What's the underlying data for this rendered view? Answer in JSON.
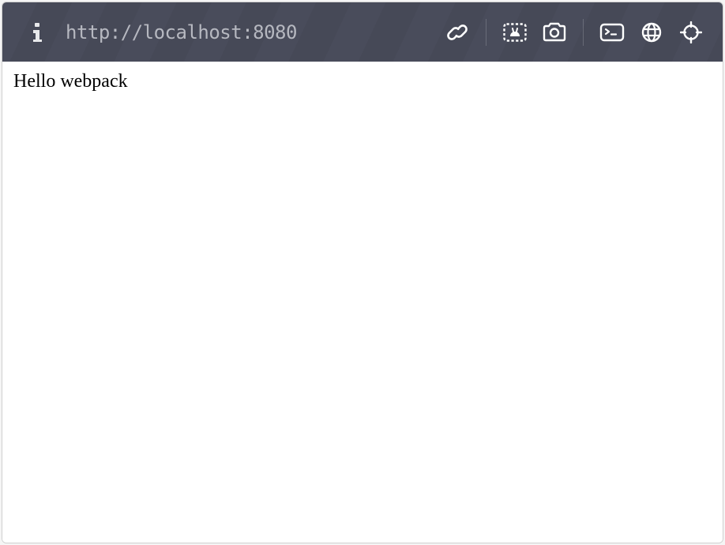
{
  "toolbar": {
    "url": "http://localhost:8080"
  },
  "page": {
    "body_text": "Hello webpack"
  }
}
